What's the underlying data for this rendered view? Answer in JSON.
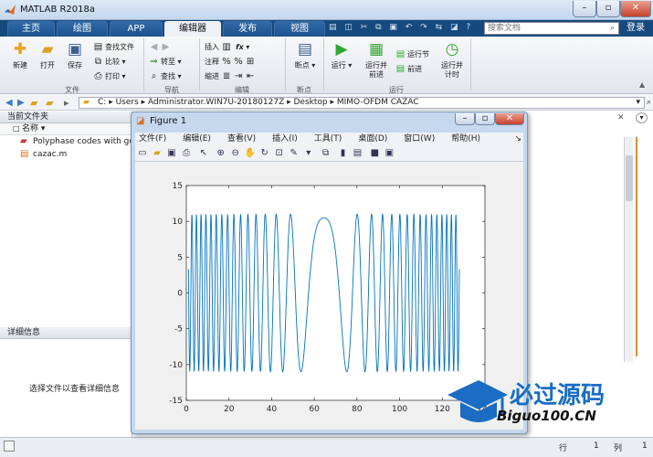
{
  "window": {
    "title": "MATLAB R2018a",
    "min": "–",
    "max": "▫",
    "close": "✕"
  },
  "tabs": [
    "主页",
    "绘图",
    "APP",
    "编辑器",
    "发布",
    "视图"
  ],
  "active_tab": 3,
  "search_placeholder": "搜索文档",
  "login": "登录",
  "ribbon": {
    "file": {
      "new": "新建",
      "open": "打开",
      "save": "保存",
      "find_file": "查找文件",
      "compare": "比较",
      "print": "打印",
      "label": "文件"
    },
    "nav": {
      "goto": "转至",
      "find": "查找",
      "label": "导航"
    },
    "edit": {
      "insert": "插入",
      "comment": "注释",
      "indent": "缩进",
      "fx": "fx",
      "label": "编辑"
    },
    "breakpoints": {
      "bp": "断点",
      "label": "断点"
    },
    "run": {
      "run": "运行",
      "run_advance": "运行并\n前进",
      "run_section": "运行节",
      "advance": "前进",
      "run_time": "运行并\n计时",
      "label": "运行"
    }
  },
  "path": [
    "C:",
    "Users",
    "Administrator.WIN7U-20180127Z",
    "Desktop",
    "MIMO-OFDM CAZAC"
  ],
  "current_folder": {
    "title": "当前文件夹",
    "col_name": "名称",
    "files": [
      {
        "name": "Polyphase codes with go",
        "icon": "pdf-icon"
      },
      {
        "name": "cazac.m",
        "icon": "m-file-icon"
      }
    ]
  },
  "details": {
    "title": "详细信息",
    "message": "选择文件以查看详细信息"
  },
  "status": {
    "row_label": "行",
    "row": "1",
    "col_label": "列",
    "col": "1"
  },
  "figure": {
    "title": "Figure 1",
    "menu": [
      "文件(F)",
      "编辑(E)",
      "查看(V)",
      "插入(I)",
      "工具(T)",
      "桌面(D)",
      "窗口(W)",
      "帮助(H)"
    ],
    "min": "–",
    "max": "▫",
    "close": "✕"
  },
  "chart_data": {
    "type": "line",
    "title": "",
    "xlabel": "",
    "ylabel": "",
    "xlim": [
      0,
      140
    ],
    "ylim": [
      -15,
      15
    ],
    "xticks": [
      0,
      20,
      40,
      60,
      80,
      100,
      120,
      140
    ],
    "yticks": [
      -15,
      -10,
      -5,
      0,
      5,
      10,
      15
    ],
    "series_color": "#0072bd",
    "series": [
      {
        "x_start": 1,
        "x_end": 128
      }
    ]
  },
  "watermark": {
    "cn": "必过源码",
    "en": "Biguo100.CN"
  },
  "colors": {
    "tabbar": "#164a7f",
    "accent": "#0072bd"
  }
}
